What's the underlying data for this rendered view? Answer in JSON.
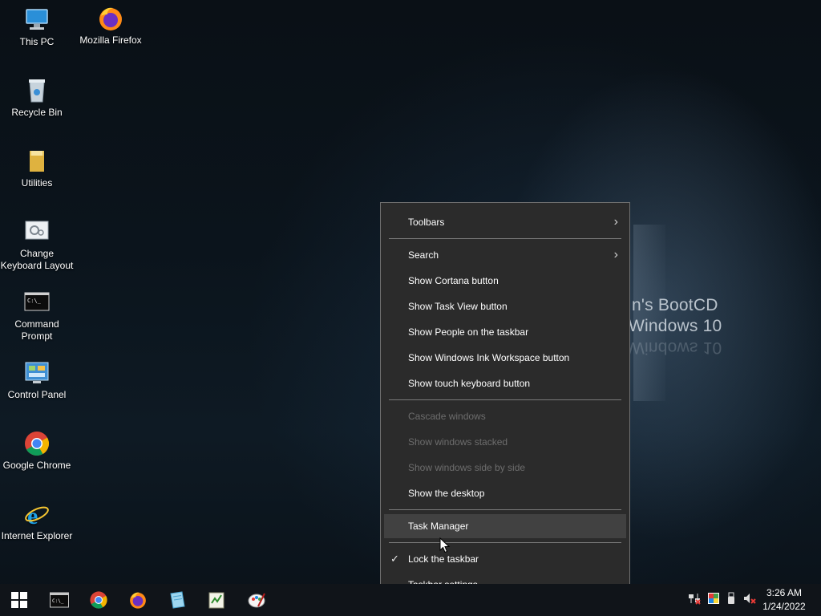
{
  "desktop": {
    "icons": [
      {
        "label": "This PC",
        "icon": "computer-icon"
      },
      {
        "label": "Mozilla Firefox",
        "icon": "firefox-icon"
      },
      {
        "label": "Recycle Bin",
        "icon": "recycle-bin-icon"
      },
      {
        "label": "Utilities",
        "icon": "folder-icon"
      },
      {
        "label": "Change Keyboard Layout",
        "icon": "keyboard-settings-icon"
      },
      {
        "label": "Command Prompt",
        "icon": "command-prompt-icon"
      },
      {
        "label": "Control Panel",
        "icon": "control-panel-icon"
      },
      {
        "label": "Google Chrome",
        "icon": "chrome-icon"
      },
      {
        "label": "Internet Explorer",
        "icon": "internet-explorer-icon"
      }
    ],
    "wallpaper_text": {
      "line1": "n's BootCD",
      "line2": "Windows 10",
      "line3": "Windows 10"
    }
  },
  "context_menu": {
    "items": {
      "toolbars": "Toolbars",
      "search": "Search",
      "cortana": "Show Cortana button",
      "task_view": "Show Task View button",
      "people": "Show People on the taskbar",
      "ink": "Show Windows Ink Workspace button",
      "touch_keyboard": "Show touch keyboard button",
      "cascade": "Cascade windows",
      "stacked": "Show windows stacked",
      "side_by_side": "Show windows side by side",
      "show_desktop": "Show the desktop",
      "task_manager": "Task Manager",
      "lock_taskbar": "Lock the taskbar",
      "taskbar_settings": "Taskbar settings"
    },
    "arrow_glyph": "›",
    "check_glyph": "✓"
  },
  "taskbar": {
    "apps": [
      "start-icon",
      "command-prompt-icon",
      "chrome-icon",
      "firefox-icon",
      "notepad-icon",
      "registry-editor-icon",
      "paint-icon"
    ],
    "clock": {
      "time": "3:26 AM",
      "date": "1/24/2022"
    },
    "tray": [
      "network-icon",
      "color-icon",
      "usb-icon",
      "volume-muted-icon"
    ]
  },
  "colors": {
    "menu_bg": "#2b2b2b",
    "menu_hover": "#414141",
    "disabled_text": "#6d6d6d",
    "taskbar_bg": "#101419"
  }
}
